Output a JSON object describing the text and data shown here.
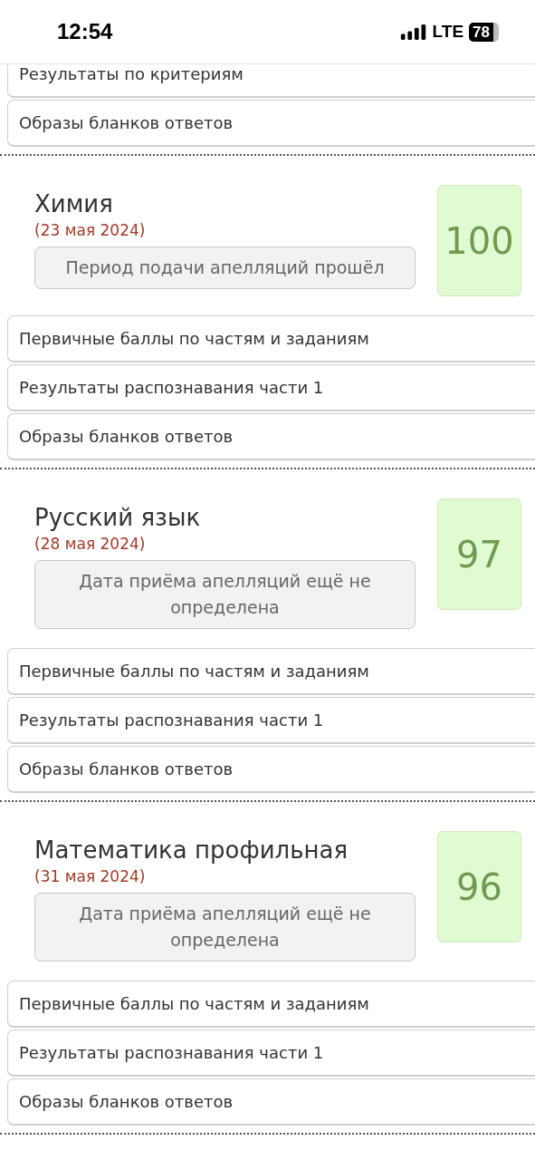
{
  "status_bar": {
    "time": "12:54",
    "network": "LTE",
    "battery": "78"
  },
  "top_links": [
    "Результаты по критериям",
    "Образы бланков ответов"
  ],
  "exams": [
    {
      "subject": "Химия",
      "date": "(23 мая 2024)",
      "appeal_status": "Период подачи апелляций прошёл",
      "score": "100",
      "links": [
        "Первичные баллы по частям и заданиям",
        "Результаты распознавания части 1",
        "Образы бланков ответов"
      ]
    },
    {
      "subject": "Русский язык",
      "date": "(28 мая 2024)",
      "appeal_status": "Дата приёма апелляций ещё не определена",
      "score": "97",
      "links": [
        "Первичные баллы по частям и заданиям",
        "Результаты распознавания части 1",
        "Образы бланков ответов"
      ]
    },
    {
      "subject": "Математика профильная",
      "date": "(31 мая 2024)",
      "appeal_status": "Дата приёма апелляций ещё не определена",
      "score": "96",
      "links": [
        "Первичные баллы по частям и заданиям",
        "Результаты распознавания части 1",
        "Образы бланков ответов"
      ]
    }
  ]
}
